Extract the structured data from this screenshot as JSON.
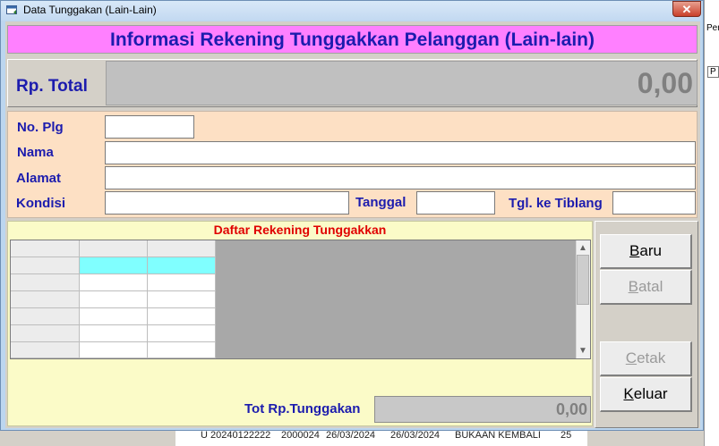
{
  "window": {
    "title": "Data Tunggakan (Lain-Lain)",
    "close_glyph": "✕"
  },
  "header": {
    "title": "Informasi Rekening Tunggakkan Pelanggan (Lain-lain)"
  },
  "total": {
    "label": "Rp. Total",
    "value": "0,00"
  },
  "form": {
    "no_plg_label": "No. Plg",
    "no_plg_value": "",
    "nama_label": "Nama",
    "nama_value": "",
    "alamat_label": "Alamat",
    "alamat_value": "",
    "kondisi_label": "Kondisi",
    "kondisi_value": "",
    "tanggal_label": "Tanggal",
    "tanggal_value": "",
    "tgl_tiblang_label": "Tgl. ke Tiblang",
    "tgl_tiblang_value": ""
  },
  "list": {
    "title": "Daftar Rekening Tunggakkan",
    "rows": 6,
    "selected_row": 1
  },
  "summary": {
    "label": "Tot Rp.Tunggakan",
    "value": "0,00"
  },
  "buttons": [
    {
      "label": "Baru",
      "accel": "B",
      "rest": "aru",
      "enabled": true
    },
    {
      "label": "Batal",
      "accel": "B",
      "rest": "atal",
      "enabled": false
    },
    {
      "label": "Cetak",
      "accel": "C",
      "rest": "etak",
      "enabled": false
    },
    {
      "label": "Keluar",
      "accel": "K",
      "rest": "eluar",
      "enabled": true
    }
  ],
  "background_app": {
    "top_text": "Per",
    "mid_text": "P",
    "bottom_cells": [
      "U 20240122222",
      "2000024",
      "26/03/2024",
      "26/03/2024",
      "BUKAAN KEMBALI",
      "25"
    ]
  },
  "colors": {
    "header_bg": "#ff80ff",
    "label_blue": "#1c1cae",
    "list_title_red": "#e00000",
    "form_bg": "#fde0c4",
    "list_bg": "#fbfbc8",
    "selected_cell": "#80ffff"
  }
}
